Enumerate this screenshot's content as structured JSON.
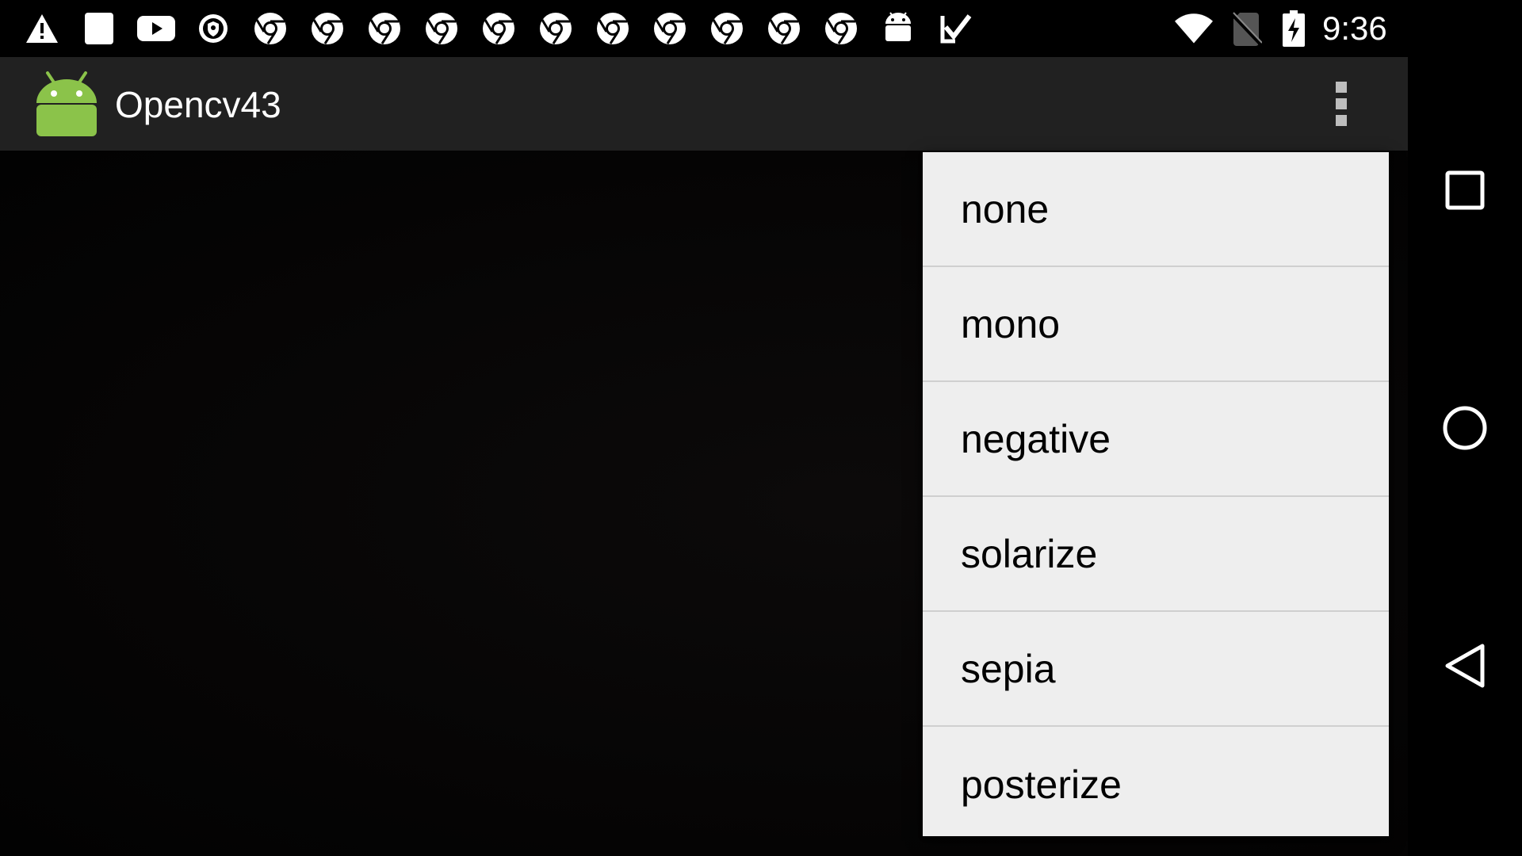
{
  "status_bar": {
    "time": "9:36",
    "notification_icons": [
      "warning-icon",
      "sd-card-icon",
      "youtube-icon",
      "vpn-shield-icon",
      "chrome-icon",
      "chrome-icon",
      "chrome-icon",
      "chrome-icon",
      "chrome-icon",
      "chrome-icon",
      "chrome-icon",
      "chrome-icon",
      "chrome-icon",
      "chrome-icon",
      "chrome-icon",
      "android-robot-icon",
      "task-check-icon"
    ],
    "system_icons": [
      "wifi-icon",
      "no-sim-icon",
      "battery-charging-icon"
    ]
  },
  "action_bar": {
    "title": "Opencv43",
    "logo": "android-app-icon",
    "overflow": "overflow-menu-icon"
  },
  "menu": {
    "items": [
      "none",
      "mono",
      "negative",
      "solarize",
      "sepia",
      "posterize"
    ]
  },
  "nav_bar": {
    "buttons": [
      "recents-icon",
      "home-icon",
      "back-icon"
    ]
  },
  "colors": {
    "action_bar_bg": "#212121",
    "menu_bg": "#eeeeee",
    "android_green": "#8bc34a"
  }
}
